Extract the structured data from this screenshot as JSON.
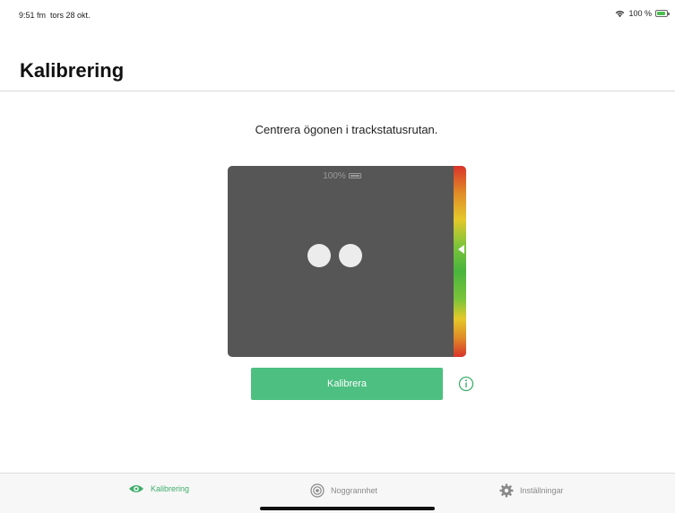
{
  "status_bar": {
    "time": "9:51 fm",
    "date": "tors 28 okt.",
    "battery_percent": "100 %",
    "icons": [
      "wifi-icon",
      "battery-charging-icon"
    ]
  },
  "page": {
    "title": "Kalibrering",
    "instruction": "Centrera ögonen i trackstatusrutan."
  },
  "track_status": {
    "battery_text": "100%",
    "icon": "battery-icon",
    "eyes_detected": 2,
    "gauge_colors": [
      "#d9342b",
      "#e4c82a",
      "#49b43d"
    ]
  },
  "actions": {
    "calibrate_label": "Kalibrera",
    "info_icon": "info-icon"
  },
  "tab_bar": {
    "items": [
      {
        "label": "Kalibrering",
        "icon": "eye-icon",
        "active": true
      },
      {
        "label": "Noggrannhet",
        "icon": "target-icon",
        "active": false
      },
      {
        "label": "Inställningar",
        "icon": "gear-icon",
        "active": false
      }
    ]
  },
  "colors": {
    "accent": "#4dbf81",
    "track_box": "#565656"
  }
}
